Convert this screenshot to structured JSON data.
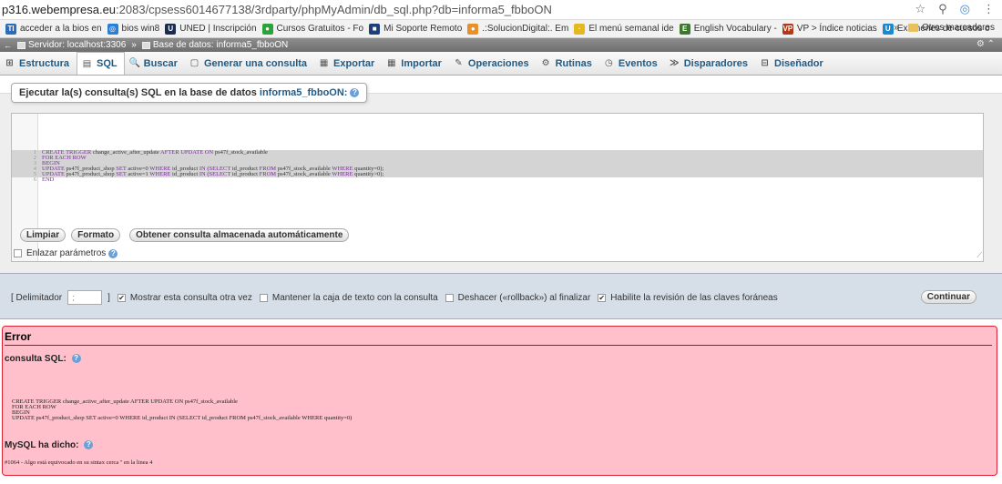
{
  "browser": {
    "url_host": "p316.webempresa.eu",
    "url_rest": ":2083/cpsess6014677138/3rdparty/phpMyAdmin/db_sql.php?db=informa5_fbboON",
    "bookmarks": [
      {
        "label": "acceder a la bios en",
        "icon": "acceder-bookmark-icon",
        "color": "#2a6ebb",
        "glyph": "TI"
      },
      {
        "label": "bios win8",
        "icon": "bios-bookmark-icon",
        "color": "#2b7fd9",
        "glyph": "◎"
      },
      {
        "label": "UNED | Inscripción",
        "icon": "uned-bookmark-icon",
        "color": "#1d2b50",
        "glyph": "U"
      },
      {
        "label": "Cursos Gratuitos - Fo",
        "icon": "cursos-bookmark-icon",
        "color": "#2aa33a",
        "glyph": "●"
      },
      {
        "label": "Mi Soporte Remoto",
        "icon": "soporte-bookmark-icon",
        "color": "#1c3f7a",
        "glyph": "■"
      },
      {
        "label": ".:SolucionDigital:. Em",
        "icon": "solucion-bookmark-icon",
        "color": "#e8902a",
        "glyph": "●"
      },
      {
        "label": "El menú semanal ide",
        "icon": "menu-bookmark-icon",
        "color": "#e5b820",
        "glyph": "·"
      },
      {
        "label": "English Vocabulary -",
        "icon": "english-bookmark-icon",
        "color": "#3a7a2a",
        "glyph": "E"
      },
      {
        "label": "VP > Índice noticias",
        "icon": "vp-bookmark-icon",
        "color": "#b03a1a",
        "glyph": "VP"
      },
      {
        "label": "Examenes de cursos o",
        "icon": "examenes-bookmark-icon",
        "color": "#1a8ad0",
        "glyph": "U"
      }
    ],
    "overflow_label": "»",
    "other_bookmarks": "Otros marcadores"
  },
  "pma": {
    "breadcrumb_server": "Servidor: localhost:3306",
    "breadcrumb_sep": "»",
    "breadcrumb_db": "Base de datos: informa5_fbboON",
    "tabs": [
      {
        "label": "Estructura",
        "icon": "structure-icon",
        "glyph": "⊞"
      },
      {
        "label": "SQL",
        "icon": "sql-icon",
        "glyph": "▤"
      },
      {
        "label": "Buscar",
        "icon": "search-icon",
        "glyph": "🔍"
      },
      {
        "label": "Generar una consulta",
        "icon": "query-icon",
        "glyph": "▢"
      },
      {
        "label": "Exportar",
        "icon": "export-icon",
        "glyph": "▦"
      },
      {
        "label": "Importar",
        "icon": "import-icon",
        "glyph": "▦"
      },
      {
        "label": "Operaciones",
        "icon": "operations-icon",
        "glyph": "✎"
      },
      {
        "label": "Rutinas",
        "icon": "routines-icon",
        "glyph": "⚙"
      },
      {
        "label": "Eventos",
        "icon": "events-icon",
        "glyph": "◷"
      },
      {
        "label": "Disparadores",
        "icon": "triggers-icon",
        "glyph": "≫"
      },
      {
        "label": "Diseñador",
        "icon": "designer-icon",
        "glyph": "⊟"
      }
    ],
    "active_tab": 1
  },
  "query": {
    "title_prefix": "Ejecutar la(s) consulta(s) SQL en la base de datos",
    "db_name": "informa5_fbboON:",
    "lines": [
      {
        "n": "1",
        "text": "CREATE TRIGGER change_active_after_update AFTER UPDATE ON ps47f_stock_available"
      },
      {
        "n": "2",
        "text": "FOR EACH ROW"
      },
      {
        "n": "3",
        "text": "BEGIN"
      },
      {
        "n": "4",
        "text": "UPDATE ps47f_product_shop SET active=0 WHERE id_product IN (SELECT id_product FROM ps47f_stock_available WHERE quantity=0);"
      },
      {
        "n": "5",
        "text": "UPDATE ps47f_product_shop SET active=1 WHERE id_product IN (SELECT id_product FROM ps47f_stock_available WHERE quantity>0);"
      },
      {
        "n": "6",
        "text": "END"
      }
    ],
    "btn_clear": "Limpiar",
    "btn_format": "Formato",
    "btn_stored": "Obtener consulta almacenada automáticamente",
    "bind_params": "Enlazar parámetros"
  },
  "delimiter": {
    "label_open": "[ Delimitador",
    "value": ";",
    "label_close": "]",
    "opt_show": "Mostrar esta consulta otra vez",
    "opt_keep": "Mantener la caja de texto con la consulta",
    "opt_rollback": "Deshacer («rollback») al finalizar",
    "opt_fk": "Habilite la revisión de las claves foráneas",
    "continue": "Continuar"
  },
  "error": {
    "title": "Error",
    "sql_label": "consulta SQL:",
    "sql_text": "CREATE TRIGGER change_active_after_update AFTER UPDATE ON ps47f_stock_available\nFOR EACH ROW\nBEGIN\nUPDATE ps47f_product_shop SET active=0 WHERE id_product IN (SELECT id_product FROM ps47f_stock_available WHERE quantity=0)",
    "mysql_label": "MySQL ha dicho:",
    "message": "#1064 - Algo está equivocado en su sintax cerca '' en la linea 4"
  }
}
